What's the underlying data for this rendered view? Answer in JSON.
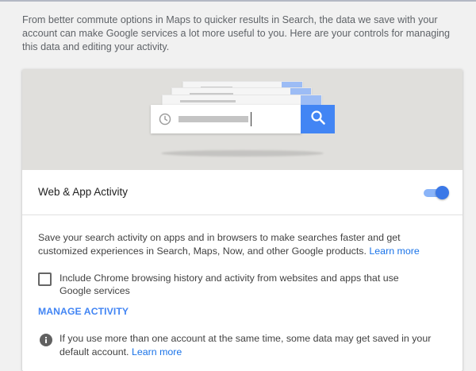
{
  "intro": {
    "text": "From better commute options in Maps to quicker results in Search, the data we save with your account can make Google services a lot more useful to you. Here are your controls for managing this data and editing your activity."
  },
  "hero": {
    "search_icon": "search-icon",
    "history_icon": "clock-icon",
    "accent_color": "#4285f4"
  },
  "setting": {
    "title": "Web & App Activity",
    "toggle_on": true,
    "description": "Save your search activity on apps and in browsers to make searches faster and get customized experiences in Search, Maps, Now, and other Google products.",
    "learn_more": "Learn more",
    "checkbox_label": "Include Chrome browsing history and activity from websites and apps that use Google services",
    "checkbox_checked": false,
    "manage_label": "MANAGE ACTIVITY"
  },
  "info": {
    "icon": "info-icon",
    "text": "If you use more than one account at the same time, some data may get saved in your default account.",
    "learn_more": "Learn more"
  }
}
